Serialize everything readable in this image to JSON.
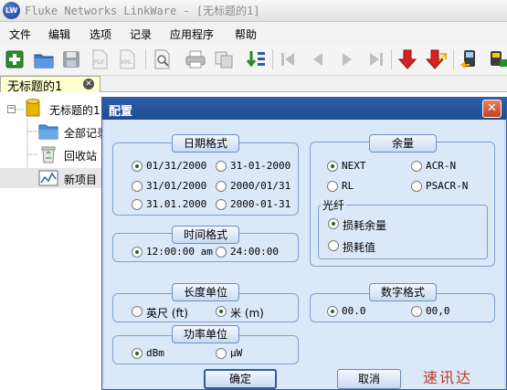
{
  "window": {
    "logo": "LW",
    "title": "Fluke Networks LinkWare - [无标题的1]"
  },
  "menu": [
    "文件",
    "编辑",
    "选项",
    "记录",
    "应用程序",
    "帮助"
  ],
  "toolbar_icons": [
    "new-record-icon",
    "open-folder-icon",
    "save-icon",
    "pdf-icon",
    "xml-icon",
    "preview-icon",
    "print-icon",
    "copy-icon",
    "sort-icon",
    "first-icon",
    "prev-icon",
    "next-icon",
    "last-icon",
    "import-down-icon",
    "export-icon",
    "tester-icon",
    "network-icon"
  ],
  "tab": {
    "label": "无标题的1"
  },
  "tree": {
    "root": {
      "label": "无标题的1",
      "expander": "−"
    },
    "items": [
      {
        "label": "全部记录"
      },
      {
        "label": "回收站"
      },
      {
        "label": "新项目"
      }
    ]
  },
  "dialog": {
    "title": "配置",
    "close_label": "✕",
    "date_format": {
      "title": "日期格式",
      "options": [
        "01/31/2000",
        "31-01-2000",
        "31/01/2000",
        "2000/01/31",
        "31.01.2000",
        "2000-01-31"
      ],
      "selected": 0
    },
    "time_format": {
      "title": "时间格式",
      "options": [
        "12:00:00 am",
        "24:00:00"
      ],
      "selected": 0
    },
    "length_unit": {
      "title": "长度单位",
      "options": [
        "英尺 (ft)",
        "米 (m)"
      ],
      "selected": 1
    },
    "power_unit": {
      "title": "功率单位",
      "options": [
        "dBm",
        "μW"
      ],
      "selected": 0
    },
    "margin": {
      "title": "余量",
      "options": [
        "NEXT",
        "ACR-N",
        "RL",
        "PSACR-N"
      ],
      "selected": 0,
      "fiber": {
        "title": "光纤",
        "options": [
          "损耗余量",
          "损耗值"
        ],
        "selected": 0
      }
    },
    "number_format": {
      "title": "数字格式",
      "options": [
        "00.0",
        "00,0"
      ],
      "selected": 0
    },
    "ok_label": "确定",
    "cancel_label": "取消"
  },
  "watermark": "速讯达"
}
